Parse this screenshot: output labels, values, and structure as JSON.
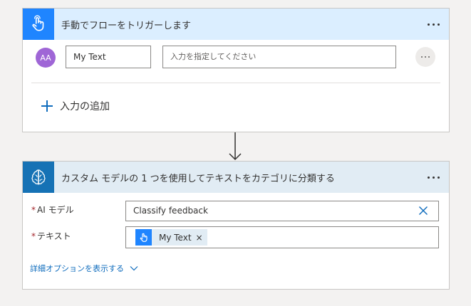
{
  "trigger": {
    "title": "手動でフローをトリガーします",
    "input": {
      "avatar_text": "AA",
      "name_value": "My Text",
      "prompt_placeholder": "入力を指定してください"
    },
    "add_input_label": "入力の追加"
  },
  "action": {
    "title": "カスタム モデルの 1 つを使用してテキストをカテゴリに分類する",
    "fields": {
      "ai_model": {
        "required_mark": "*",
        "label": "AI モデル",
        "value": "Classify feedback"
      },
      "text": {
        "required_mark": "*",
        "label": "テキスト",
        "token_label": "My Text",
        "token_remove": "×"
      }
    },
    "advanced_label": "詳細オプションを表示する"
  },
  "icons": {
    "trigger": "hand-tap-icon",
    "action": "ai-brain-icon",
    "more": "more-dots-icon",
    "add": "plus-icon",
    "clear": "close-icon",
    "expand": "chevron-down-icon",
    "connector": "arrow-down-icon"
  },
  "colors": {
    "trigger_header_bg": "#dbeeff",
    "trigger_icon_bg": "#1f85ff",
    "action_header_bg": "#e1ecf4",
    "action_icon_bg": "#1672b5",
    "avatar_bg": "#9f66d6",
    "link": "#0f6cbd",
    "required": "#a4262c"
  }
}
